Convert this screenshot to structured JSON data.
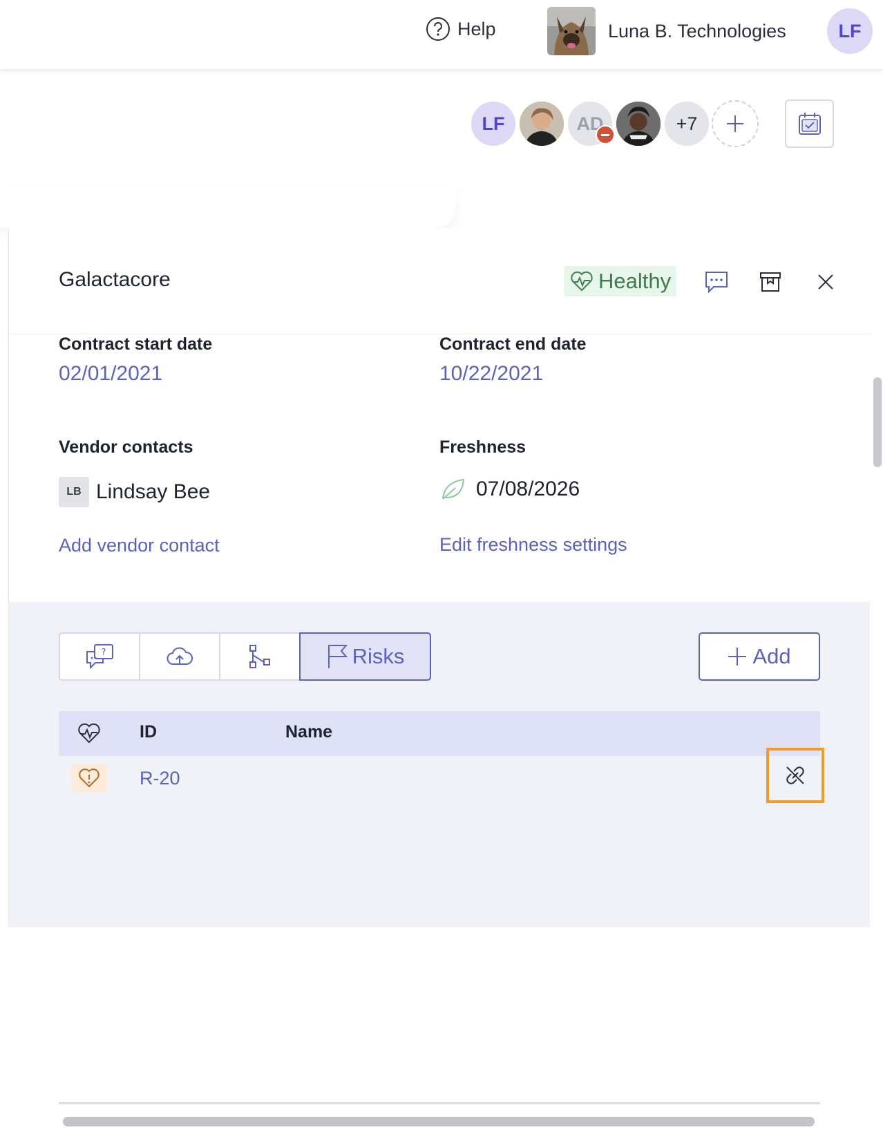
{
  "topbar": {
    "help_label": "Help",
    "org_name": "Luna B. Technologies",
    "user_initials": "LF"
  },
  "collaborators": {
    "avatars": [
      {
        "initials": "LF"
      },
      {
        "initials": ""
      },
      {
        "initials": "AD"
      },
      {
        "initials": ""
      }
    ],
    "more_label": "+7",
    "add_label": "+"
  },
  "panel": {
    "vendor_name": "Galactacore",
    "health_status": "Healthy",
    "status_colors": {
      "healthy_bg": "#e7f5ea",
      "healthy_text": "#3c7c4f"
    },
    "contract_start_label": "Contract start date",
    "contract_start_value": "02/01/2021",
    "contract_end_label": "Contract end date",
    "contract_end_value": "10/22/2021",
    "vendor_contacts_label": "Vendor contacts",
    "contact": {
      "initials": "LB",
      "name": "Lindsay Bee"
    },
    "add_contact_label": "Add vendor contact",
    "freshness_label": "Freshness",
    "freshness_date": "07/08/2026",
    "edit_freshness_label": "Edit freshness settings"
  },
  "tabs": [
    {
      "icon": "questions-chat-icon",
      "label": ""
    },
    {
      "icon": "cloud-upload-icon",
      "label": ""
    },
    {
      "icon": "workflow-icon",
      "label": ""
    },
    {
      "icon": "flag-icon",
      "label": "Risks",
      "active": true
    }
  ],
  "add_button_label": "Add",
  "risks_table": {
    "columns": [
      "",
      "ID",
      "Name"
    ],
    "rows": [
      {
        "health_icon": "warning-heart-icon",
        "id": "R-20",
        "name": "",
        "action_icon": "unlink-icon"
      }
    ]
  },
  "accent_color": "#5b62b8",
  "highlight_color": "#f39a2c"
}
